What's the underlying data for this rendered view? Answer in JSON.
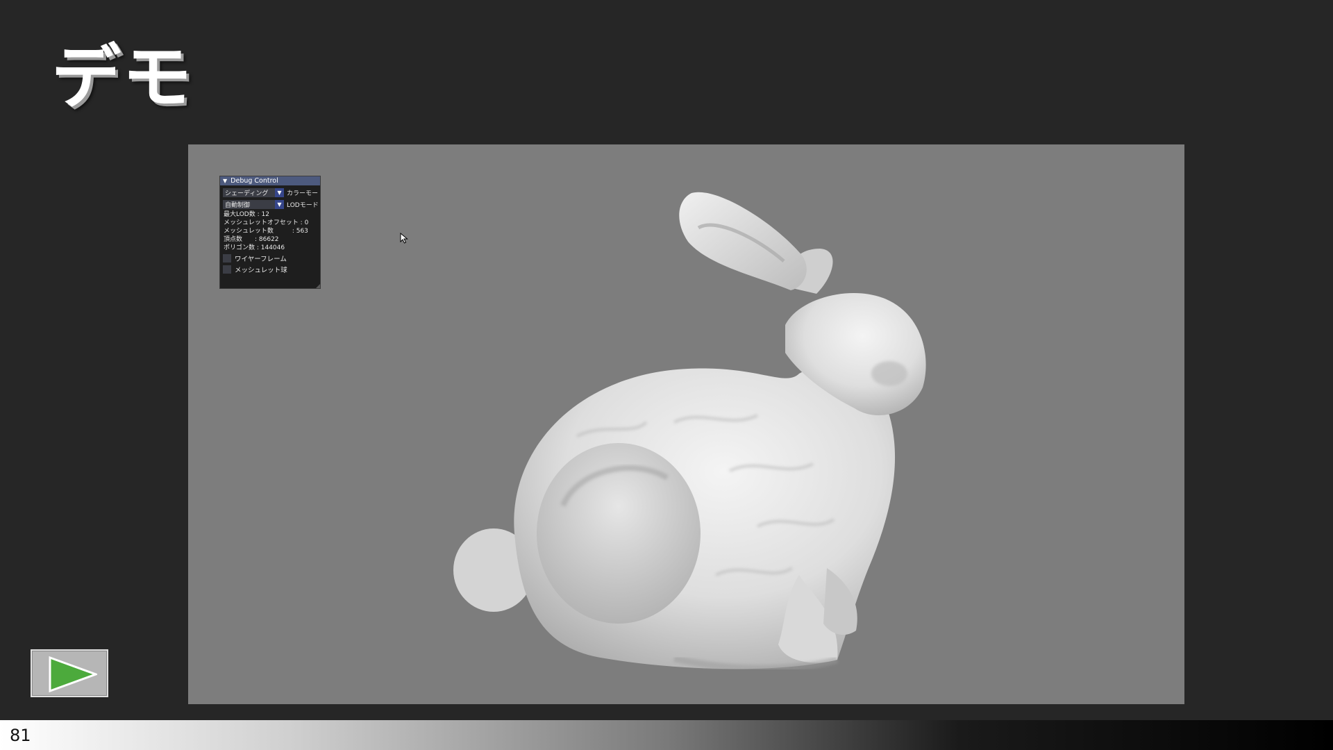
{
  "slide": {
    "title": "デモ",
    "page_number": "81"
  },
  "debug_panel": {
    "header": "Debug Control",
    "shading_combo": {
      "value": "シェーディング",
      "label": "カラーモード"
    },
    "lod_combo": {
      "value": "自動制御",
      "label": "LODモード"
    },
    "stats": [
      {
        "label": "最大LOD数",
        "value": "12",
        "text": "最大LOD数 : 12"
      },
      {
        "label": "メッシュレットオフセット",
        "value": "0",
        "text": "メッシュレットオフセット : 0"
      },
      {
        "label": "メッシュレット数",
        "value": "563",
        "text": "メッシュレット数　　　: 563"
      },
      {
        "label": "頂点数",
        "value": "86622",
        "text": "頂点数　　: 86622"
      },
      {
        "label": "ポリゴン数",
        "value": "144046",
        "text": "ポリゴン数 : 144046"
      }
    ],
    "checkboxes": [
      {
        "label": "ワイヤーフレーム",
        "checked": false
      },
      {
        "label": "メッシュレット球",
        "checked": false
      }
    ]
  },
  "video": {
    "background_color": "#7d7d7d",
    "subject": "stanford-bunny-render"
  },
  "play_button": {
    "icon": "play-icon",
    "color": "#4caa3c"
  },
  "colors": {
    "slide_background": "#262626",
    "panel_header": "#4d5a7e",
    "combo_arrow": "#36468a"
  }
}
